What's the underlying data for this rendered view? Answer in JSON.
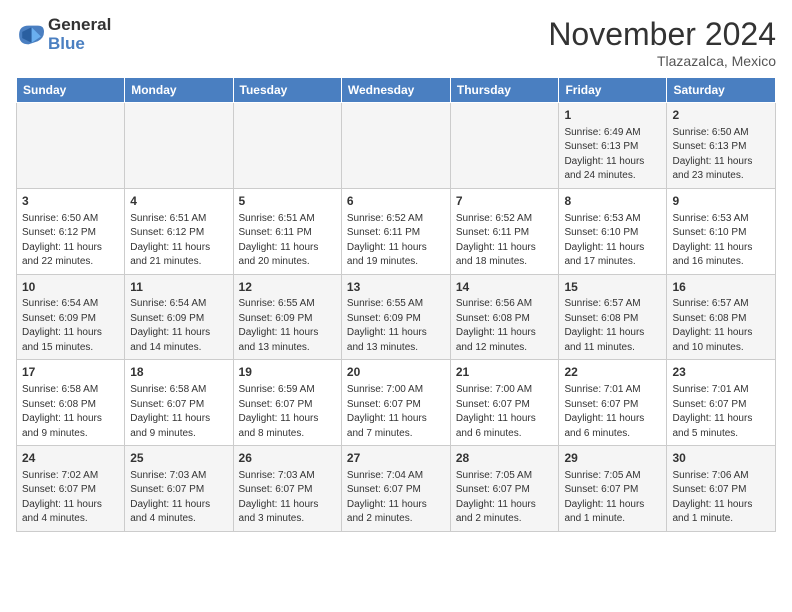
{
  "header": {
    "logo_line1": "General",
    "logo_line2": "Blue",
    "month_title": "November 2024",
    "location": "Tlazazalca, Mexico"
  },
  "weekdays": [
    "Sunday",
    "Monday",
    "Tuesday",
    "Wednesday",
    "Thursday",
    "Friday",
    "Saturday"
  ],
  "weeks": [
    [
      {
        "day": "",
        "info": ""
      },
      {
        "day": "",
        "info": ""
      },
      {
        "day": "",
        "info": ""
      },
      {
        "day": "",
        "info": ""
      },
      {
        "day": "",
        "info": ""
      },
      {
        "day": "1",
        "info": "Sunrise: 6:49 AM\nSunset: 6:13 PM\nDaylight: 11 hours\nand 24 minutes."
      },
      {
        "day": "2",
        "info": "Sunrise: 6:50 AM\nSunset: 6:13 PM\nDaylight: 11 hours\nand 23 minutes."
      }
    ],
    [
      {
        "day": "3",
        "info": "Sunrise: 6:50 AM\nSunset: 6:12 PM\nDaylight: 11 hours\nand 22 minutes."
      },
      {
        "day": "4",
        "info": "Sunrise: 6:51 AM\nSunset: 6:12 PM\nDaylight: 11 hours\nand 21 minutes."
      },
      {
        "day": "5",
        "info": "Sunrise: 6:51 AM\nSunset: 6:11 PM\nDaylight: 11 hours\nand 20 minutes."
      },
      {
        "day": "6",
        "info": "Sunrise: 6:52 AM\nSunset: 6:11 PM\nDaylight: 11 hours\nand 19 minutes."
      },
      {
        "day": "7",
        "info": "Sunrise: 6:52 AM\nSunset: 6:11 PM\nDaylight: 11 hours\nand 18 minutes."
      },
      {
        "day": "8",
        "info": "Sunrise: 6:53 AM\nSunset: 6:10 PM\nDaylight: 11 hours\nand 17 minutes."
      },
      {
        "day": "9",
        "info": "Sunrise: 6:53 AM\nSunset: 6:10 PM\nDaylight: 11 hours\nand 16 minutes."
      }
    ],
    [
      {
        "day": "10",
        "info": "Sunrise: 6:54 AM\nSunset: 6:09 PM\nDaylight: 11 hours\nand 15 minutes."
      },
      {
        "day": "11",
        "info": "Sunrise: 6:54 AM\nSunset: 6:09 PM\nDaylight: 11 hours\nand 14 minutes."
      },
      {
        "day": "12",
        "info": "Sunrise: 6:55 AM\nSunset: 6:09 PM\nDaylight: 11 hours\nand 13 minutes."
      },
      {
        "day": "13",
        "info": "Sunrise: 6:55 AM\nSunset: 6:09 PM\nDaylight: 11 hours\nand 13 minutes."
      },
      {
        "day": "14",
        "info": "Sunrise: 6:56 AM\nSunset: 6:08 PM\nDaylight: 11 hours\nand 12 minutes."
      },
      {
        "day": "15",
        "info": "Sunrise: 6:57 AM\nSunset: 6:08 PM\nDaylight: 11 hours\nand 11 minutes."
      },
      {
        "day": "16",
        "info": "Sunrise: 6:57 AM\nSunset: 6:08 PM\nDaylight: 11 hours\nand 10 minutes."
      }
    ],
    [
      {
        "day": "17",
        "info": "Sunrise: 6:58 AM\nSunset: 6:08 PM\nDaylight: 11 hours\nand 9 minutes."
      },
      {
        "day": "18",
        "info": "Sunrise: 6:58 AM\nSunset: 6:07 PM\nDaylight: 11 hours\nand 9 minutes."
      },
      {
        "day": "19",
        "info": "Sunrise: 6:59 AM\nSunset: 6:07 PM\nDaylight: 11 hours\nand 8 minutes."
      },
      {
        "day": "20",
        "info": "Sunrise: 7:00 AM\nSunset: 6:07 PM\nDaylight: 11 hours\nand 7 minutes."
      },
      {
        "day": "21",
        "info": "Sunrise: 7:00 AM\nSunset: 6:07 PM\nDaylight: 11 hours\nand 6 minutes."
      },
      {
        "day": "22",
        "info": "Sunrise: 7:01 AM\nSunset: 6:07 PM\nDaylight: 11 hours\nand 6 minutes."
      },
      {
        "day": "23",
        "info": "Sunrise: 7:01 AM\nSunset: 6:07 PM\nDaylight: 11 hours\nand 5 minutes."
      }
    ],
    [
      {
        "day": "24",
        "info": "Sunrise: 7:02 AM\nSunset: 6:07 PM\nDaylight: 11 hours\nand 4 minutes."
      },
      {
        "day": "25",
        "info": "Sunrise: 7:03 AM\nSunset: 6:07 PM\nDaylight: 11 hours\nand 4 minutes."
      },
      {
        "day": "26",
        "info": "Sunrise: 7:03 AM\nSunset: 6:07 PM\nDaylight: 11 hours\nand 3 minutes."
      },
      {
        "day": "27",
        "info": "Sunrise: 7:04 AM\nSunset: 6:07 PM\nDaylight: 11 hours\nand 2 minutes."
      },
      {
        "day": "28",
        "info": "Sunrise: 7:05 AM\nSunset: 6:07 PM\nDaylight: 11 hours\nand 2 minutes."
      },
      {
        "day": "29",
        "info": "Sunrise: 7:05 AM\nSunset: 6:07 PM\nDaylight: 11 hours\nand 1 minute."
      },
      {
        "day": "30",
        "info": "Sunrise: 7:06 AM\nSunset: 6:07 PM\nDaylight: 11 hours\nand 1 minute."
      }
    ]
  ]
}
